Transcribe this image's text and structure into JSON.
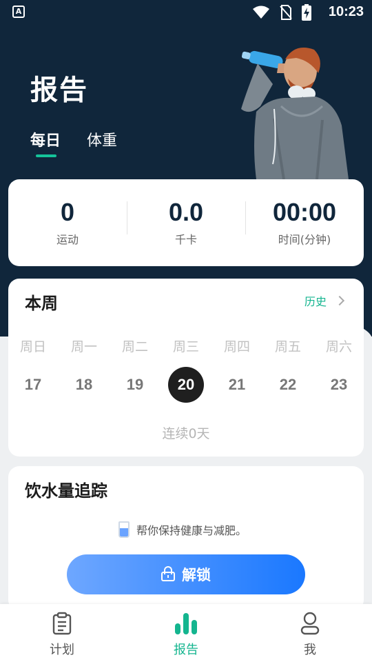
{
  "status_bar": {
    "time": "10:23",
    "app_letter": "A"
  },
  "header": {
    "title": "报告",
    "tabs": [
      {
        "label": "每日",
        "active": true
      },
      {
        "label": "体重",
        "active": false
      }
    ]
  },
  "stats": [
    {
      "value": "0",
      "label": "运动"
    },
    {
      "value": "0.0",
      "label": "千卡"
    },
    {
      "value": "00:00",
      "label": "时间(分钟)"
    }
  ],
  "week": {
    "title": "本周",
    "history_label": "历史",
    "days": [
      {
        "name": "周日",
        "date": "17"
      },
      {
        "name": "周一",
        "date": "18"
      },
      {
        "name": "周二",
        "date": "19"
      },
      {
        "name": "周三",
        "date": "20"
      },
      {
        "name": "周四",
        "date": "21"
      },
      {
        "name": "周五",
        "date": "22"
      },
      {
        "name": "周六",
        "date": "23"
      }
    ],
    "today_index": 3,
    "streak": "连续0天"
  },
  "water": {
    "title": "饮水量追踪",
    "tip": "帮你保持健康与减肥。",
    "unlock_label": "解锁"
  },
  "bottom_nav": [
    {
      "label": "计划",
      "icon": "clipboard-icon",
      "active": false
    },
    {
      "label": "报告",
      "icon": "bar-chart-icon",
      "active": true
    },
    {
      "label": "我",
      "icon": "profile-icon",
      "active": false
    }
  ],
  "colors": {
    "header_bg": "#10263b",
    "accent": "#14b58f",
    "unlock_gradient_start": "#6ea7ff",
    "unlock_gradient_end": "#1a78ff"
  }
}
